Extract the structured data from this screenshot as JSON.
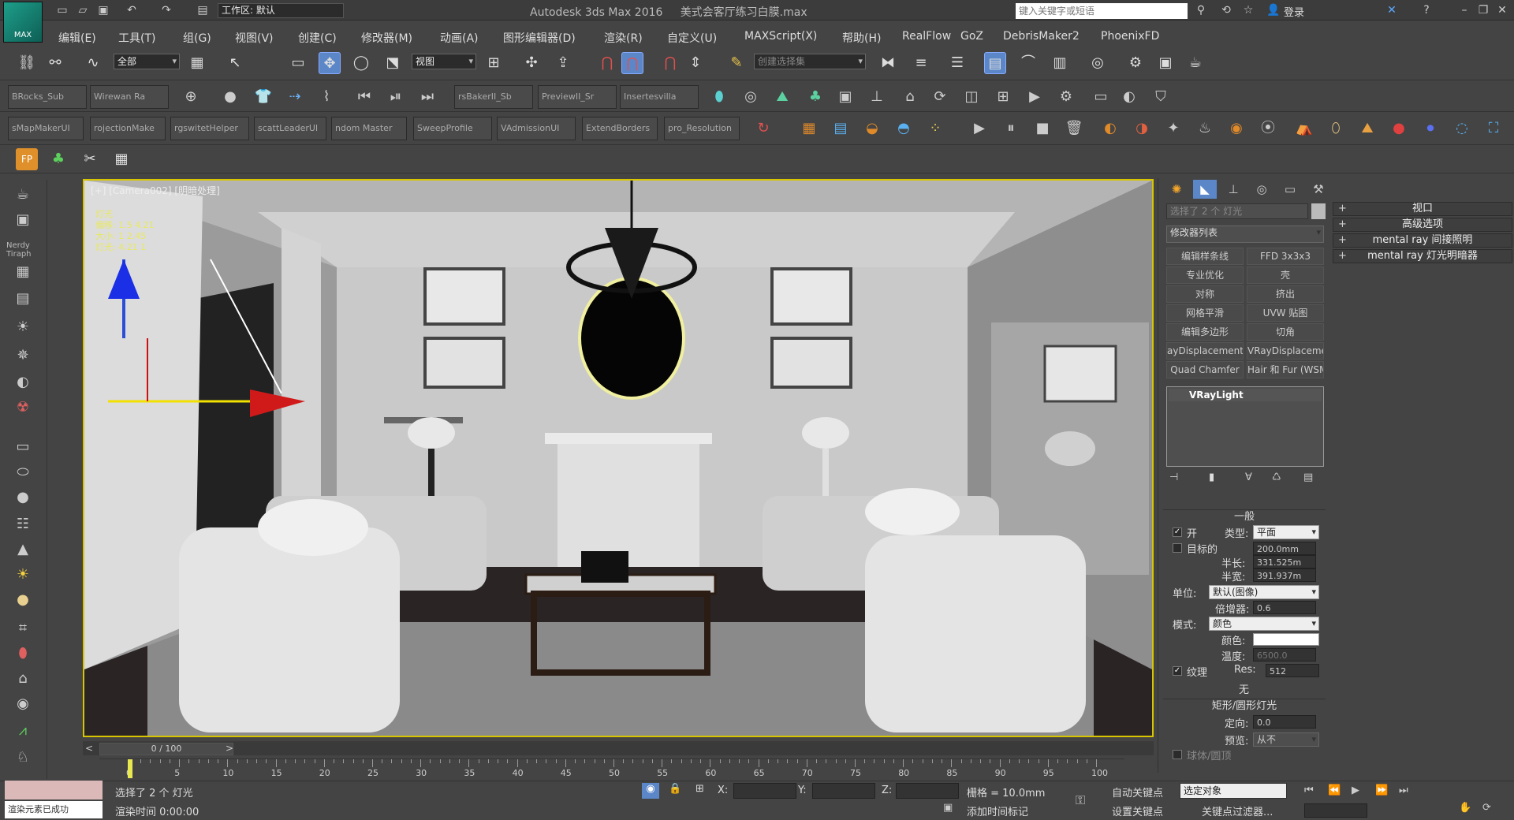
{
  "titlebar": {
    "logo_text": "MAX",
    "workspace_label": "工作区: 默认",
    "title": "Autodesk 3ds Max 2016",
    "file": "美式会客厅练习白膜.max",
    "search_placeholder": "键入关键字或短语",
    "login": "登录"
  },
  "menus": [
    "编辑(E)",
    "工具(T)",
    "组(G)",
    "视图(V)",
    "创建(C)",
    "修改器(M)",
    "动画(A)",
    "图形编辑器(D)",
    "渲染(R)",
    "自定义(U)",
    "MAXScript(X)",
    "帮助(H)",
    "RealFlow",
    "GoZ",
    "DebrisMaker2",
    "PhoenixFD"
  ],
  "main_toolbar": {
    "filter": "全部",
    "ref_coord": "视图",
    "named_sel": "创建选择集"
  },
  "script_buttons_row1": [
    "BRocks_Sub",
    "Wirewan Ra",
    "rsBakerII_Sb",
    "PreviewII_Sr",
    "Insertesvilla"
  ],
  "script_buttons_row2": [
    "sMapMakerUI",
    "rojectionMake",
    "rgswitetHelper",
    "scattLeaderUI",
    "ndom Master",
    "SweepProfile",
    "VAdmissionUI",
    "ExtendBorders",
    "pro_Resolution"
  ],
  "viewport": {
    "label": "[+] [Camera002] [明暗处理]",
    "info_lines": [
      "灯光",
      "偏移: 1.5 4.21",
      "大小: 1 2.45",
      "灯光: 4.21 1"
    ]
  },
  "command_panel": {
    "object_name": "选择了 2 个 灯光",
    "modifier_list": "修改器列表",
    "modifier_buttons": [
      [
        "编辑样条线",
        "FFD 3x3x3"
      ],
      [
        "专业优化",
        "壳"
      ],
      [
        "对称",
        "挤出"
      ],
      [
        "网格平滑",
        "UVW 贴图"
      ],
      [
        "编辑多边形",
        "切角"
      ],
      [
        "ayDisplacementM",
        "VRayDisplacementMod"
      ],
      [
        "Quad Chamfer",
        "Hair 和 Fur (WSM"
      ]
    ],
    "stack_item": "VRayLight",
    "rollout_general": "一般",
    "on_label": "开",
    "type_label": "类型:",
    "type_value": "平面",
    "target_label": "目标的",
    "target_value": "200.0mm",
    "half_len_label": "半长:",
    "half_len_value": "331.525m",
    "half_wid_label": "半宽:",
    "half_wid_value": "391.937m",
    "unit_label": "单位:",
    "unit_value": "默认(图像)",
    "mult_label": "倍增器:",
    "mult_value": "0.6",
    "mode_label": "模式:",
    "mode_value": "颜色",
    "color_label": "颜色:",
    "temp_label": "温度:",
    "temp_value": "6500.0",
    "texture_label": "纹理",
    "res_label": "Res:",
    "res_value": "512",
    "none_label": "无",
    "rollout_rect": "矩形/圆形灯光",
    "dir_label": "定向:",
    "dir_value": "0.0",
    "preview_label": "预览:",
    "preview_value": "从不",
    "disk_label": "球体/圆顶"
  },
  "far_panel": [
    "视口",
    "高级选项",
    "mental ray 间接照明",
    "mental ray 灯光明暗器"
  ],
  "timeline": {
    "frame": "0 / 100",
    "ticks": [
      "0",
      "5",
      "10",
      "15",
      "20",
      "25",
      "30",
      "35",
      "40",
      "45",
      "50",
      "55",
      "60",
      "65",
      "70",
      "75",
      "80",
      "85",
      "90",
      "95",
      "100"
    ]
  },
  "status": {
    "selected": "选择了 2 个 灯光",
    "render_time": "渲染时间 0:00:00",
    "x_label": "X:",
    "y_label": "Y:",
    "z_label": "Z:",
    "grid": "栅格 = 10.0mm",
    "add_tag": "添加时间标记",
    "auto_key": "自动关键点",
    "set_key": "设置关键点",
    "sel_obj": "选定对象",
    "key_filter": "关键点过滤器...",
    "maxscript_listener": "渲染元素已成功"
  }
}
